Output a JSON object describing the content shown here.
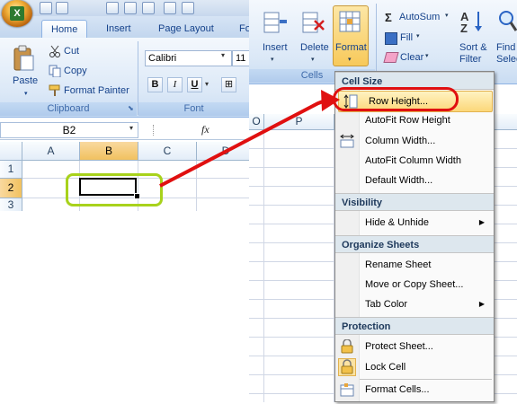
{
  "home_tabs": [
    "Home",
    "Insert",
    "Page Layout",
    "Fo"
  ],
  "clipboard": {
    "paste": "Paste",
    "cut": "Cut",
    "copy": "Copy",
    "format_painter": "Format Painter",
    "group": "Clipboard"
  },
  "font": {
    "name": "Calibri",
    "size": "11",
    "group": "Font",
    "bold": "B",
    "italic": "I",
    "underline": "U"
  },
  "name_box": "B2",
  "fx": "fx",
  "columns": [
    "A",
    "B",
    "C",
    "D"
  ],
  "rows": [
    "1",
    "2",
    "3"
  ],
  "cells_group": {
    "insert": "Insert",
    "delete": "Delete",
    "format": "Format",
    "label": "Cells"
  },
  "editing": {
    "autosum": "AutoSum",
    "fill": "Fill",
    "clear": "Clear",
    "sort_line1": "Sort &",
    "sort_line2": "Filter",
    "find_line1": "Find",
    "find_line2": "Selec"
  },
  "right_columns": [
    "O",
    "P"
  ],
  "menu": {
    "cell_size_header": "Cell Size",
    "row_height": "Row Height...",
    "autofit_row_height": "AutoFit Row Height",
    "column_width": "Column Width...",
    "autofit_column_width": "AutoFit Column Width",
    "default_width": "Default Width...",
    "visibility_header": "Visibility",
    "hide_unhide": "Hide & Unhide",
    "organize_header": "Organize Sheets",
    "rename_sheet": "Rename Sheet",
    "move_copy_sheet": "Move or Copy Sheet...",
    "tab_color": "Tab Color",
    "protection_header": "Protection",
    "protect_sheet": "Protect Sheet...",
    "lock_cell": "Lock Cell",
    "format_cells": "Format Cells..."
  },
  "colors": {
    "selection_highlight": "#f1c15f",
    "menu_highlight": "#fcd779",
    "annotation_red": "#e01010",
    "annotation_green": "#a8d21c"
  }
}
